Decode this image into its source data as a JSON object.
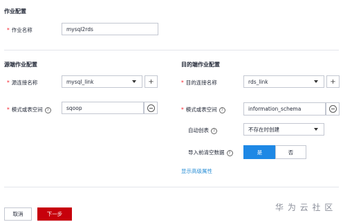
{
  "job_config": {
    "title": "作业配置",
    "job_name_label": "作业名称",
    "job_name_value": "mysql2rds"
  },
  "source": {
    "title": "源端作业配置",
    "link_label": "源连接名称",
    "link_value": "mysql_link",
    "schema_label": "模式或表空间",
    "schema_value": "sqoop"
  },
  "destination": {
    "title": "目的端作业配置",
    "link_label": "目的连接名称",
    "link_value": "rds_link",
    "schema_label": "模式或表空间",
    "schema_value": "information_schema",
    "auto_create_label": "自动创表",
    "auto_create_value": "不存在时创建",
    "clear_label": "导入前清空数据",
    "clear_yes": "是",
    "clear_no": "否",
    "clear_selected": "是",
    "advanced_link": "显示高级属性"
  },
  "footer": {
    "cancel": "取消",
    "next": "下一步"
  },
  "watermark": "华 为 云 社 区",
  "icons": {
    "add": "plus-icon",
    "dropdown": "chevron-down-icon",
    "clear": "minus-circle-icon",
    "help": "help-icon"
  },
  "colors": {
    "primary_red": "#c7000b",
    "accent_blue": "#1e88e5",
    "link_blue": "#2b8fd6",
    "required": "#f5222d"
  }
}
